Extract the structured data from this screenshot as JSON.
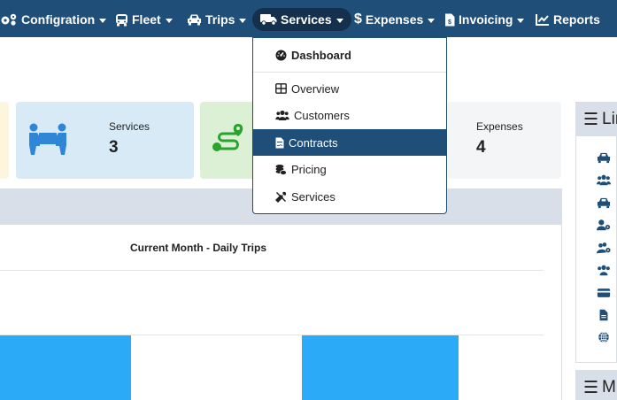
{
  "navbar": {
    "items": [
      {
        "label": "Configration",
        "icon": "gears-icon"
      },
      {
        "label": "Fleet",
        "icon": "bus-icon"
      },
      {
        "label": "Trips",
        "icon": "car-icon"
      },
      {
        "label": "Services",
        "icon": "truck-icon"
      },
      {
        "label": "Expenses",
        "icon": "dollar-icon"
      },
      {
        "label": "Invoicing",
        "icon": "invoice-icon"
      },
      {
        "label": "Reports",
        "icon": "line-chart-icon"
      }
    ]
  },
  "dropdown": {
    "items": [
      {
        "label": "Dashboard",
        "icon": "dashboard-icon"
      },
      {
        "label": "Overview",
        "icon": "table-icon"
      },
      {
        "label": "Customers",
        "icon": "users-icon"
      },
      {
        "label": "Contracts",
        "icon": "file-contract-icon"
      },
      {
        "label": "Pricing",
        "icon": "coins-icon"
      },
      {
        "label": "Services",
        "icon": "tools-icon"
      }
    ],
    "active": "Contracts"
  },
  "cards": [
    {
      "title": "Services",
      "value": "3",
      "icon": "people-carry-icon",
      "bg": "#d9eaf7"
    },
    {
      "title": "Expenses",
      "value": "4",
      "bg": "#f4f5f7"
    }
  ],
  "chart": {
    "title": "Current Month - Daily Trips"
  },
  "chart_data": {
    "type": "bar",
    "title": "Current Month - Daily Trips",
    "note": "only partially visible; values not labeled"
  },
  "sidebar": {
    "panels": [
      {
        "header": "Lin"
      },
      {
        "header": "M"
      }
    ],
    "icons": [
      "car-icon",
      "users-icon",
      "car-icon",
      "user-gear-icon",
      "users-gear-icon",
      "users-icon",
      "credit-card-icon",
      "file-icon",
      "globe-icon"
    ]
  },
  "colors": {
    "navbar": "#1f4e79",
    "active_pill": "#14304d",
    "bar": "#2baaf8",
    "card_icon_blue": "#2f86d6",
    "route_green": "#29a32d"
  }
}
